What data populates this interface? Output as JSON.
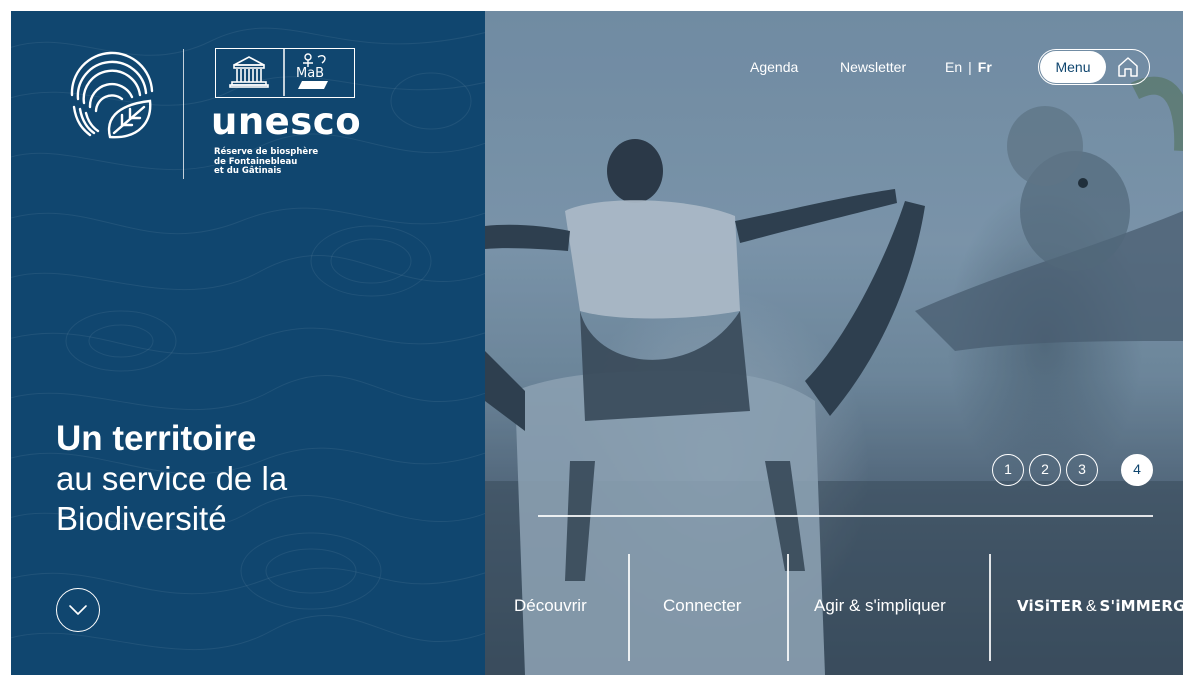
{
  "logo": {
    "org": "unesco",
    "reserve_lines": [
      "Réserve de biosphère",
      "de Fontainebleau",
      "et du Gâtinais"
    ]
  },
  "hero": {
    "line1": "Un territoire",
    "line2": "au service de la",
    "line3": "Biodiversité"
  },
  "topnav": {
    "agenda": "Agenda",
    "newsletter": "Newsletter",
    "lang_en": "En",
    "lang_sep": "|",
    "lang_fr": "Fr",
    "menu": "Menu"
  },
  "slider": {
    "items": [
      "1",
      "2",
      "3",
      "4"
    ],
    "active": 4
  },
  "categories": {
    "decouvrir": "Découvrir",
    "connecter": "Connecter",
    "agir": "Agir & s'impliquer",
    "visiter": "ViSiTER",
    "visiter_amp": "&",
    "immerger": "S'iMMERGER"
  },
  "colors": {
    "brand_blue": "#10466f",
    "white": "#ffffff"
  },
  "icons": {
    "logo": "fingerprint-leaf-logo",
    "unesco": "unesco-temple-logo",
    "mab": "mab-logo",
    "home": "home-icon",
    "scroll": "chevron-down-icon"
  }
}
